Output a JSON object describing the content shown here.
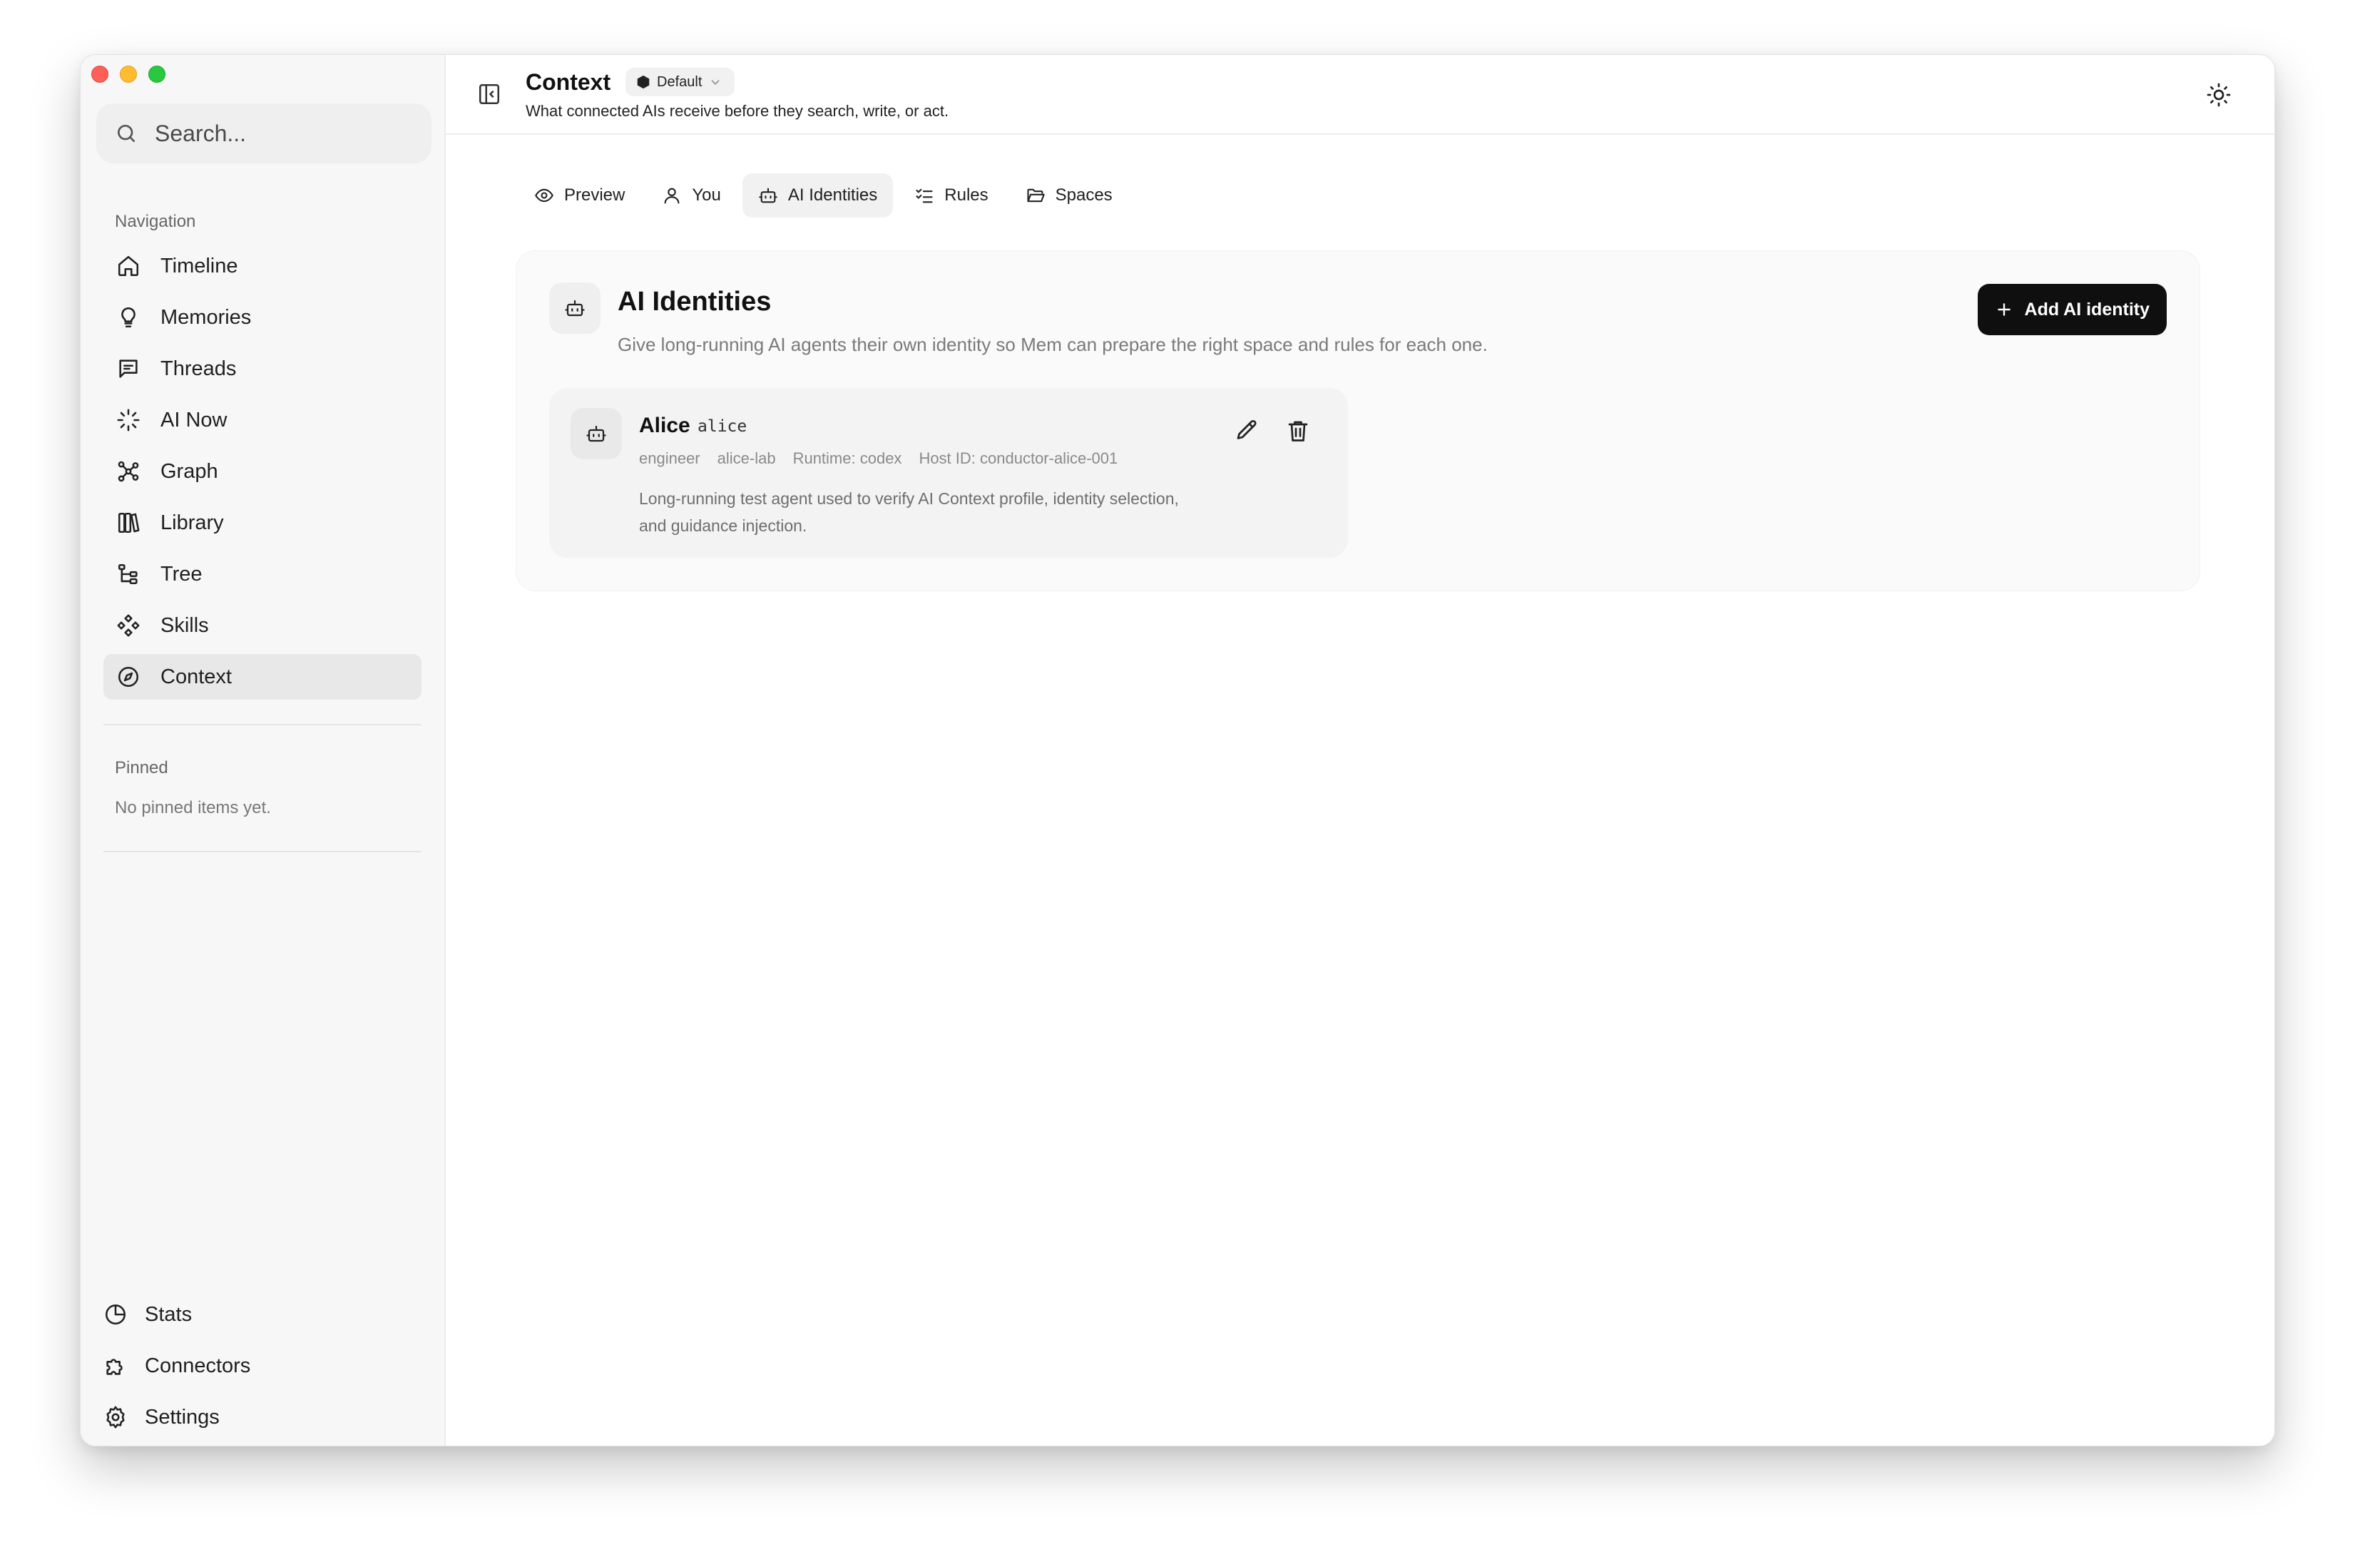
{
  "sidebar": {
    "search": {
      "placeholder": "Search..."
    },
    "navigation_label": "Navigation",
    "items": [
      {
        "label": "Timeline",
        "icon": "home-icon"
      },
      {
        "label": "Memories",
        "icon": "lightbulb-icon"
      },
      {
        "label": "Threads",
        "icon": "message-square-icon"
      },
      {
        "label": "AI Now",
        "icon": "loader-icon"
      },
      {
        "label": "Graph",
        "icon": "graph-icon"
      },
      {
        "label": "Library",
        "icon": "library-icon"
      },
      {
        "label": "Tree",
        "icon": "tree-icon"
      },
      {
        "label": "Skills",
        "icon": "skills-icon"
      },
      {
        "label": "Context",
        "icon": "compass-icon",
        "active": true
      }
    ],
    "pinned_label": "Pinned",
    "pinned_empty": "No pinned items yet.",
    "bottom_items": [
      {
        "label": "Stats",
        "icon": "pie-chart-icon"
      },
      {
        "label": "Connectors",
        "icon": "puzzle-icon"
      },
      {
        "label": "Settings",
        "icon": "gear-icon"
      }
    ]
  },
  "header": {
    "title": "Context",
    "space": "Default",
    "subtitle": "What connected AIs receive before they search, write, or act."
  },
  "tabs": [
    {
      "label": "Preview",
      "icon": "eye-icon"
    },
    {
      "label": "You",
      "icon": "user-icon"
    },
    {
      "label": "AI Identities",
      "icon": "bot-icon",
      "active": true
    },
    {
      "label": "Rules",
      "icon": "list-checks-icon"
    },
    {
      "label": "Spaces",
      "icon": "folder-open-icon"
    }
  ],
  "panel": {
    "title": "AI Identities",
    "description": "Give long-running AI agents their own identity so Mem can prepare the right space and rules for each one.",
    "add_button": "Add AI identity",
    "identities": [
      {
        "name": "Alice",
        "handle": "alice",
        "role": "engineer",
        "space": "alice-lab",
        "runtime": "Runtime: codex",
        "host_id": "Host ID: conductor-alice-001",
        "description": "Long-running test agent used to verify AI Context profile, identity selection, and guidance injection."
      }
    ]
  },
  "colors": {
    "accent_button": "#0f0f0f",
    "active_nav": "#e8e8e8",
    "sidebar_bg": "#f7f7f7",
    "traffic_red": "#fe5f57",
    "traffic_yellow": "#febc2e",
    "traffic_green": "#28c840"
  }
}
